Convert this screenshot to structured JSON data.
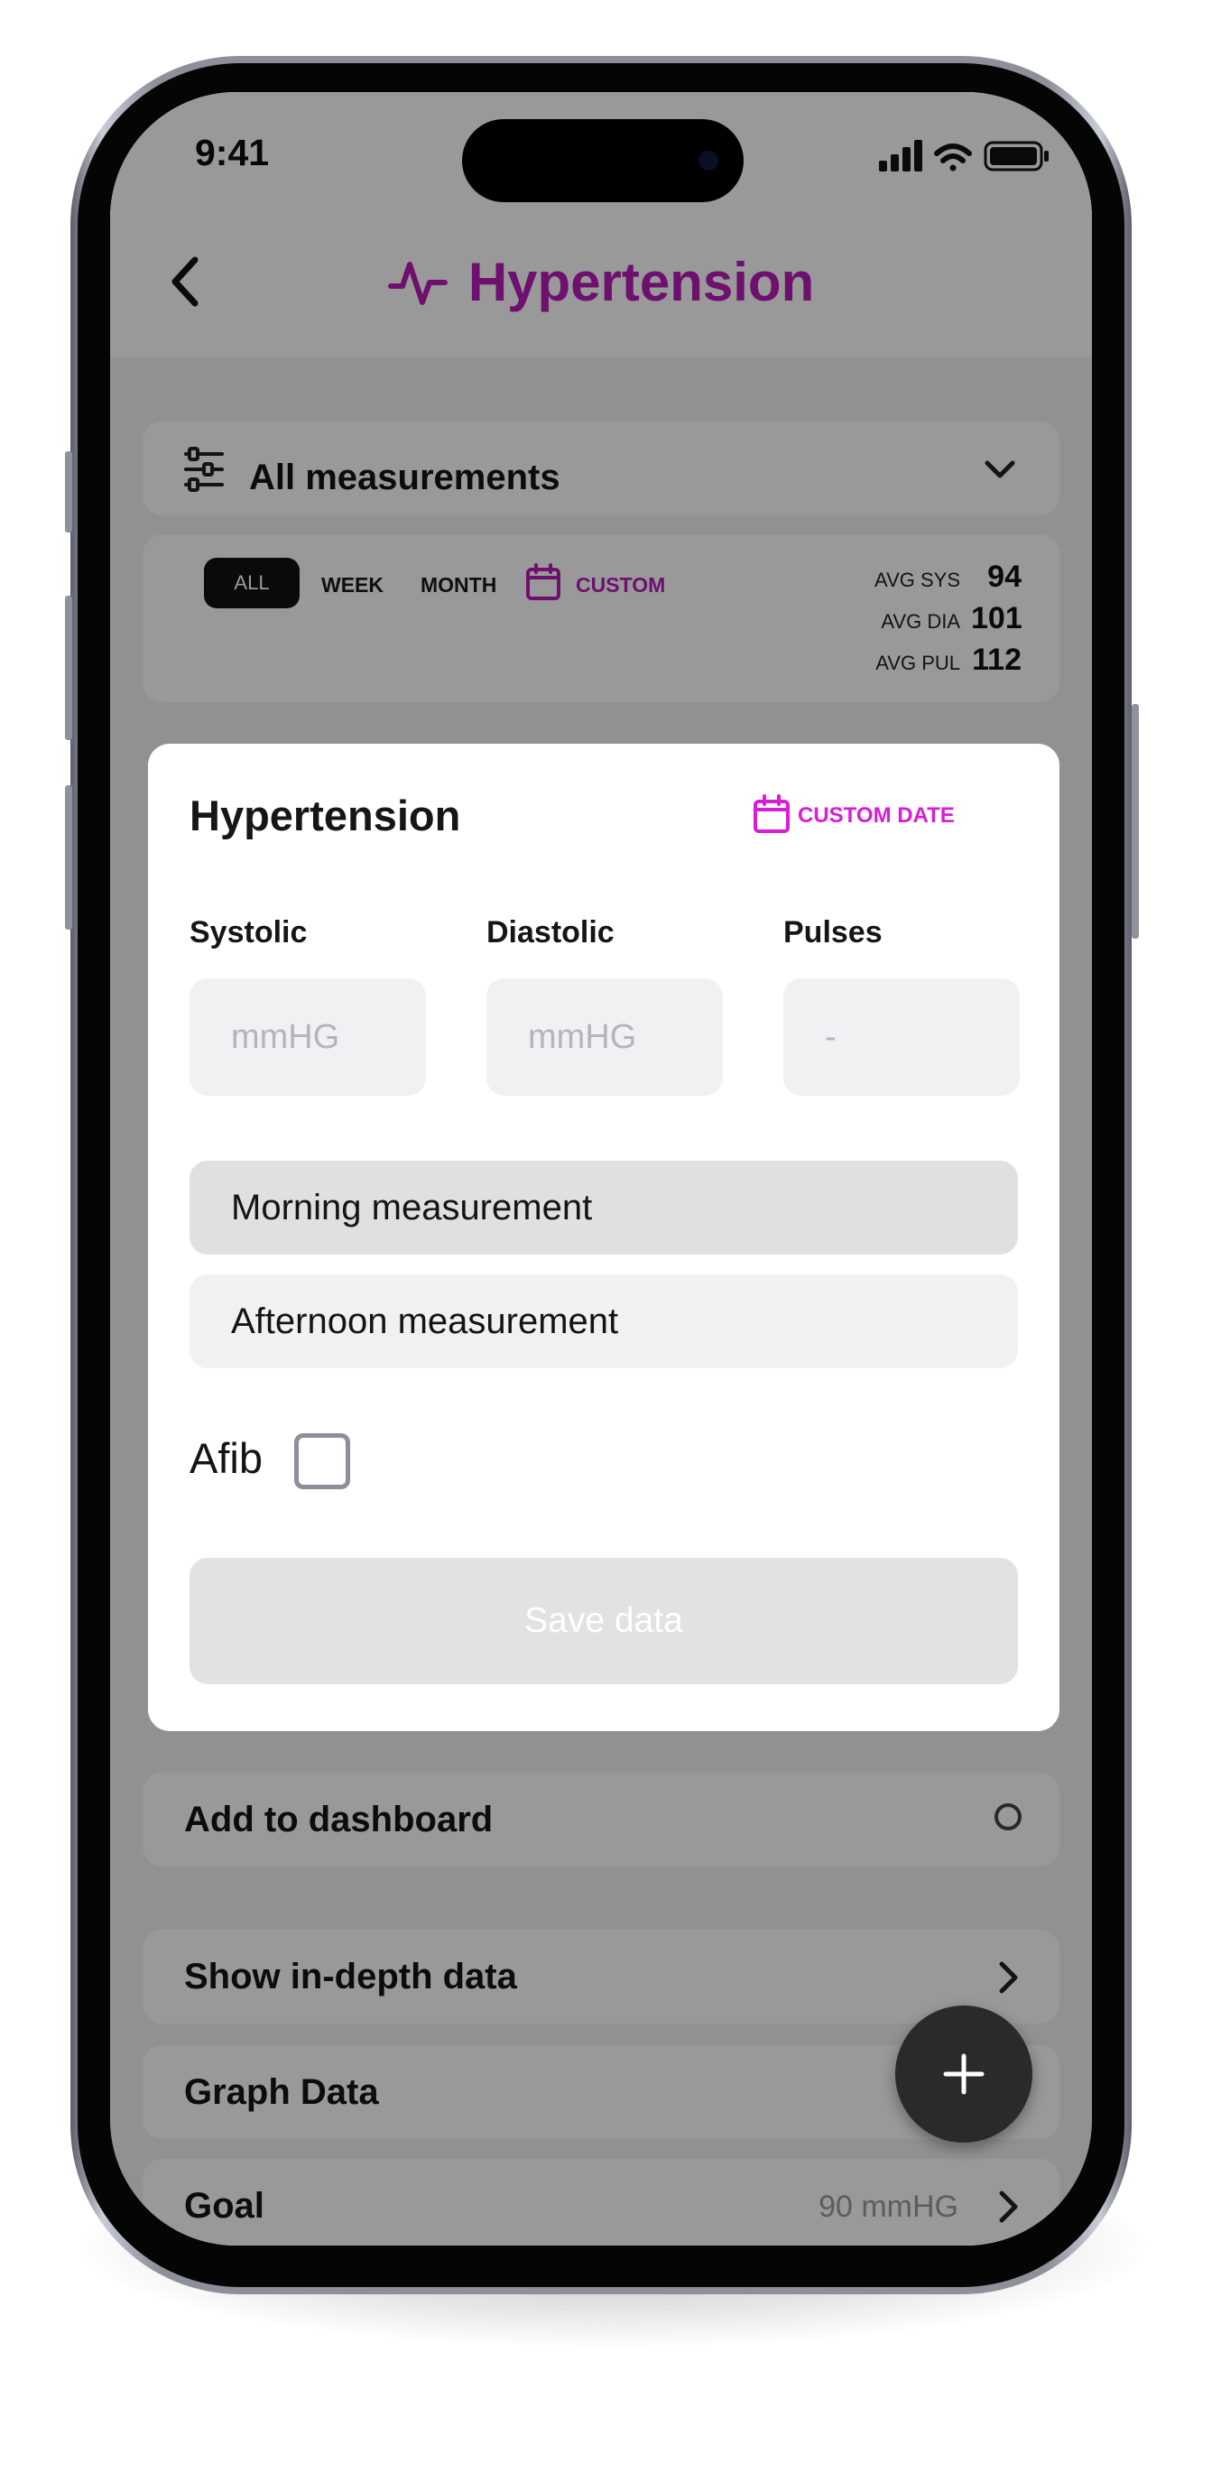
{
  "status_bar": {
    "time": "9:41",
    "icons": [
      "signal-icon",
      "wifi-icon",
      "battery-icon"
    ]
  },
  "header": {
    "title": "Hypertension",
    "back_icon": "chevron-left-icon",
    "title_icon": "heartbeat-icon"
  },
  "filter": {
    "label": "All measurements",
    "icon": "sliders-icon",
    "dropdown_icon": "chevron-down-icon"
  },
  "range_tabs": {
    "all": "ALL",
    "week": "WEEK",
    "month": "MONTH",
    "custom": "CUSTOM",
    "selected": "ALL"
  },
  "averages": [
    {
      "label": "AVG SYS",
      "value": "94"
    },
    {
      "label": "AVG DIA",
      "value": "101"
    },
    {
      "label": "AVG PUL",
      "value": "112"
    }
  ],
  "modal": {
    "title": "Hypertension",
    "custom_date": "CUSTOM DATE",
    "fields": [
      {
        "label": "Systolic",
        "placeholder": "mmHG"
      },
      {
        "label": "Diastolic",
        "placeholder": "mmHG"
      },
      {
        "label": "Pulses",
        "placeholder": "-"
      }
    ],
    "options": [
      {
        "label": "Morning measurement",
        "selected": true
      },
      {
        "label": "Afternoon measurement",
        "selected": false
      }
    ],
    "afib": {
      "label": "Afib",
      "checked": false
    },
    "save": "Save data"
  },
  "list": {
    "dashboard": "Add to dashboard",
    "in_depth": "Show in-depth data",
    "graph": "Graph Data",
    "goal": "Goal",
    "goal_value": "90 mmHG"
  },
  "colors": {
    "accent": "#b71bb8",
    "accent_bright": "#d81dd8",
    "fab": "#2a2a2a"
  }
}
